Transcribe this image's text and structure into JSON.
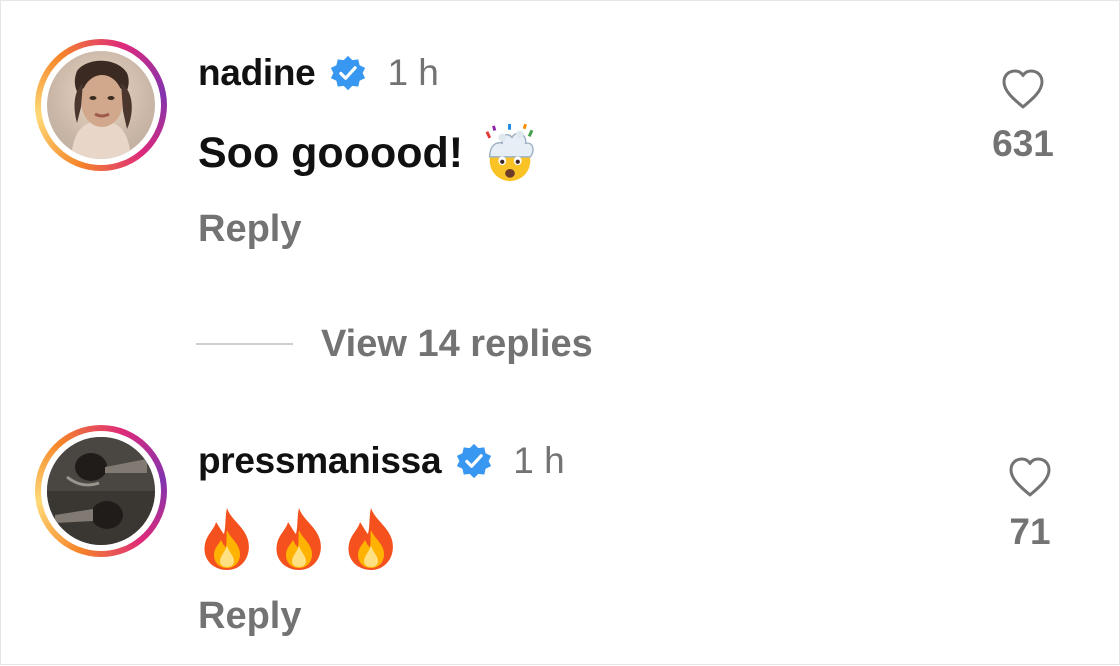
{
  "comments": [
    {
      "username": "nadine",
      "verified": true,
      "time": "1 h",
      "text": "Soo gooood!",
      "emoji": "exploding-head",
      "reply_label": "Reply",
      "like_count": "631"
    },
    {
      "username": "pressmanissa",
      "verified": true,
      "time": "1 h",
      "text": "",
      "emoji": "fire x3",
      "reply_label": "Reply",
      "like_count": "71"
    }
  ],
  "view_replies": {
    "label": "View 14 replies"
  },
  "colors": {
    "verified": "#3897f0",
    "secondary_text": "#737373",
    "primary_text": "#111111",
    "story_ring": [
      "#f58529",
      "#dd2a7b",
      "#8134af"
    ]
  },
  "icons": {
    "verified": "verified-badge-icon",
    "like": "heart-outline-icon"
  }
}
